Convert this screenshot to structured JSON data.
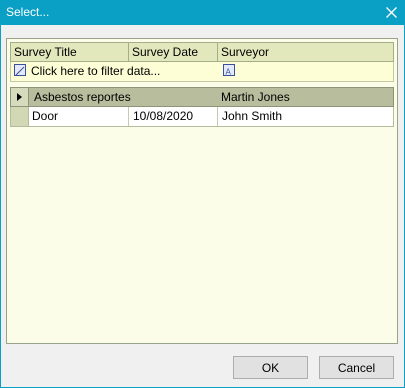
{
  "window": {
    "title": "Select...",
    "close_icon": "close-icon",
    "title_bar_color": "#0a9fc4"
  },
  "grid": {
    "columns": [
      "Survey Title",
      "Survey Date",
      "Surveyor"
    ],
    "filter": {
      "placeholder": "Click here to filter data...",
      "filter_icon": "filter-icon",
      "text_filter_icon": "text-filter-icon"
    },
    "group_row": {
      "title": "Asbestos reportes",
      "surveyor": "Martin Jones"
    },
    "rows": [
      {
        "title": "Door",
        "date": "10/08/2020",
        "surveyor": "John Smith"
      }
    ]
  },
  "buttons": {
    "ok": "OK",
    "cancel": "Cancel"
  }
}
